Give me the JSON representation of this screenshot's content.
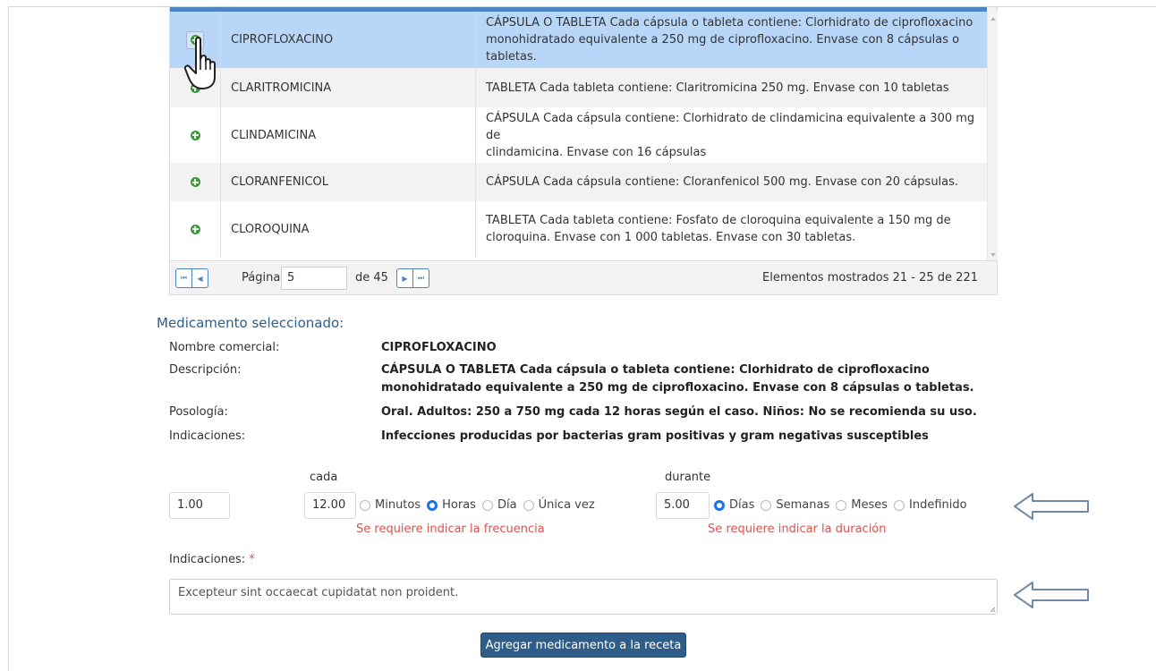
{
  "grid": {
    "rows": [
      {
        "name": "CIPROFLOXACINO",
        "desc_l1": "CÁPSULA O TABLETA Cada cápsula o tableta contiene: Clorhidrato de ciprofloxacino",
        "desc_l2": "monohidratado equivalente a 250 mg de ciprofloxacino. Envase con 8 cápsulas o tabletas.",
        "selected": true
      },
      {
        "name": "CLARITROMICINA",
        "desc_l1": "TABLETA Cada tableta contiene: Claritromicina 250 mg. Envase con 10 tabletas",
        "desc_l2": ""
      },
      {
        "name": "CLINDAMICINA",
        "desc_l1": "CÁPSULA Cada cápsula contiene: Clorhidrato de clindamicina equivalente a 300 mg de",
        "desc_l2": "clindamicina. Envase con 16 cápsulas"
      },
      {
        "name": "CLORANFENICOL",
        "desc_l1": "CÁPSULA Cada cápsula contiene: Cloranfenicol 500 mg. Envase con 20 cápsulas.",
        "desc_l2": ""
      },
      {
        "name": "CLOROQUINA",
        "desc_l1": "TABLETA Cada tableta contiene: Fosfato de cloroquina equivalente a 150 mg de",
        "desc_l2": "cloroquina. Envase con 1 000 tabletas. Envase con 30 tabletas."
      }
    ]
  },
  "pager": {
    "first": "⏮",
    "prev": "◀",
    "page_label": "Página",
    "page_value": "5",
    "of_label": "de 45",
    "next": "▶",
    "last": "⏭",
    "info": "Elementos mostrados 21 - 25 de 221"
  },
  "selected": {
    "title": "Medicamento seleccionado:",
    "name_label": "Nombre comercial:",
    "name_value": "CIPROFLOXACINO",
    "desc_label": "Descripción:",
    "desc_l1": "CÁPSULA O TABLETA Cada cápsula o tableta contiene: Clorhidrato de ciprofloxacino",
    "desc_l2": "monohidratado equivalente a 250 mg de ciprofloxacino. Envase con 8 cápsulas o tabletas.",
    "pos_label": "Posología:",
    "pos_value": "Oral. Adultos: 250 a 750 mg cada 12 horas según el caso. Niños: No se recomienda su uso.",
    "ind_label": "Indicaciones:",
    "ind_value": "Infecciones producidas por bacterias gram positivas y gram negativas susceptibles"
  },
  "dose": {
    "dose_value": "1.00",
    "cada_label": "cada",
    "freq_value": "12.00",
    "freq_options": [
      "Minutos",
      "Horas",
      "Día",
      "Única vez"
    ],
    "freq_selected": "Horas",
    "freq_error": "Se requiere indicar la frecuencia",
    "durante_label": "durante",
    "dur_value": "5.00",
    "dur_options": [
      "Días",
      "Semanas",
      "Meses",
      "Indefinido"
    ],
    "dur_selected": "Días",
    "dur_error": "Se requiere indicar la duración"
  },
  "indications": {
    "label": "Indicaciones:",
    "required_mark": "*",
    "value": "Excepteur sint occaecat cupidatat non proident."
  },
  "submit_label": "Agregar medicamento a la receta",
  "colors": {
    "accent": "#4c83c2",
    "selected_row": "#b8d6f7",
    "error": "#d9534f",
    "button": "#2f5d8a",
    "plus_icon": "#3a9a3a"
  }
}
